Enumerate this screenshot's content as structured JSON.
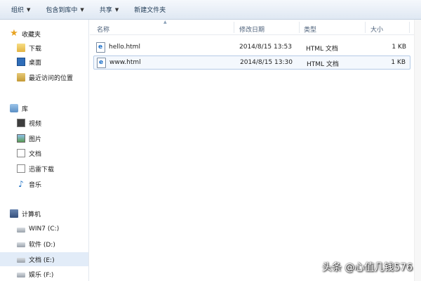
{
  "toolbar": {
    "items": [
      {
        "label": "组织",
        "dropdown": true
      },
      {
        "label": "包含到库中",
        "dropdown": true
      },
      {
        "label": "共享",
        "dropdown": true
      },
      {
        "label": "新建文件夹",
        "dropdown": false
      }
    ]
  },
  "nav": {
    "favorites": {
      "label": "收藏夹",
      "icon": "star-icon"
    },
    "favorites_items": [
      {
        "label": "下载",
        "icon": "download-folder-icon"
      },
      {
        "label": "桌面",
        "icon": "desktop-icon"
      },
      {
        "label": "最近访问的位置",
        "icon": "recent-places-icon"
      }
    ],
    "libraries": {
      "label": "库",
      "icon": "library-icon"
    },
    "libraries_items": [
      {
        "label": "视频",
        "icon": "video-icon"
      },
      {
        "label": "图片",
        "icon": "picture-icon"
      },
      {
        "label": "文档",
        "icon": "document-icon"
      },
      {
        "label": "迅雷下载",
        "icon": "thunder-download-icon"
      },
      {
        "label": "音乐",
        "icon": "music-icon"
      }
    ],
    "computer": {
      "label": "计算机",
      "icon": "computer-icon"
    },
    "computer_items": [
      {
        "label": "WIN7 (C:)",
        "icon": "drive-icon",
        "selected": false
      },
      {
        "label": "软件 (D:)",
        "icon": "drive-icon",
        "selected": false
      },
      {
        "label": "文档 (E:)",
        "icon": "drive-icon",
        "selected": true
      },
      {
        "label": "娱乐 (F:)",
        "icon": "drive-icon",
        "selected": false
      }
    ]
  },
  "columns": {
    "name": "名称",
    "modified": "修改日期",
    "type": "类型",
    "size": "大小"
  },
  "files": [
    {
      "name": "hello.html",
      "modified": "2014/8/15 13:53",
      "type": "HTML 文档",
      "size": "1 KB",
      "selected": false
    },
    {
      "name": "www.html",
      "modified": "2014/8/15 13:30",
      "type": "HTML 文档",
      "size": "1 KB",
      "selected": true
    }
  ],
  "watermark": "头条 @心值几钱576"
}
